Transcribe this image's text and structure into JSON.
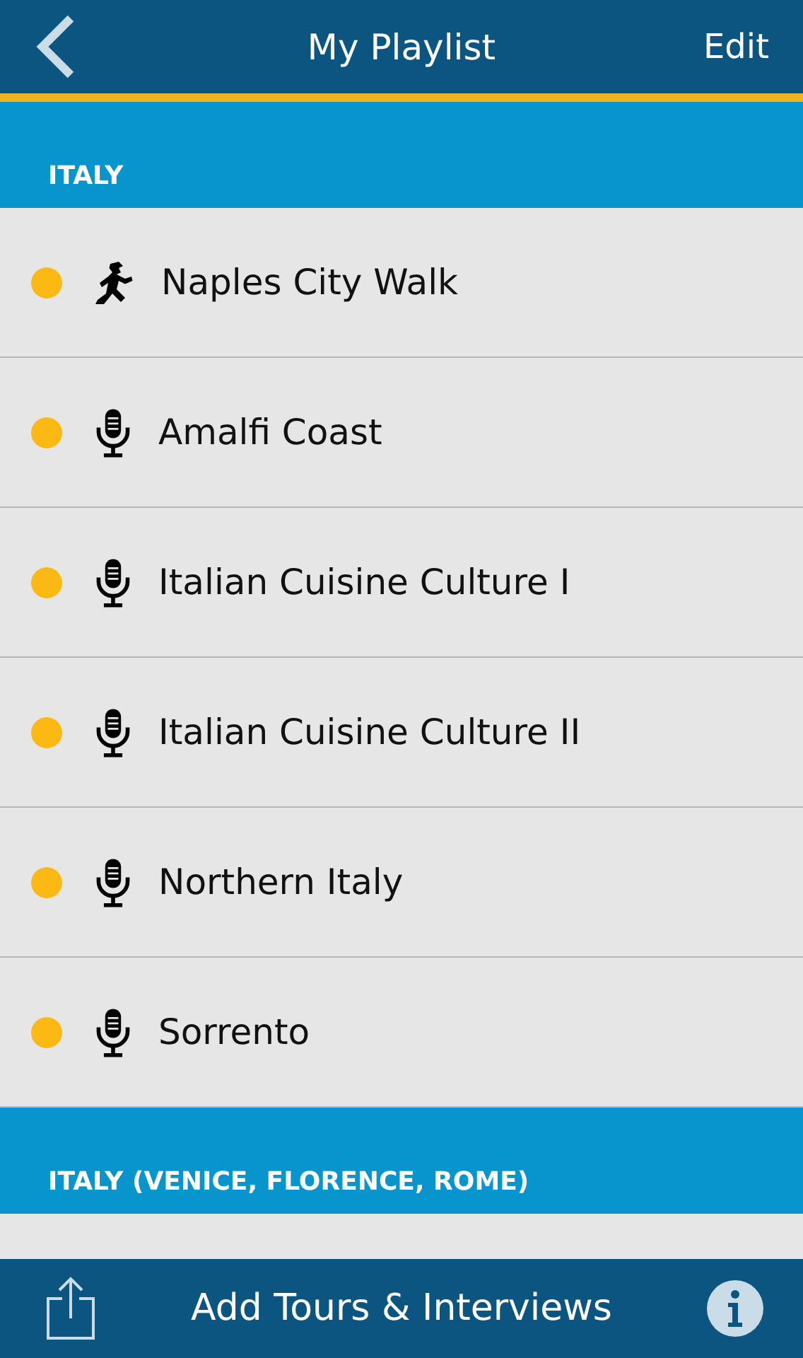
{
  "header": {
    "title": "My Playlist",
    "edit": "Edit"
  },
  "sections": [
    {
      "title": "ITALY",
      "items": [
        {
          "kind": "walk",
          "title": "Naples City Walk"
        },
        {
          "kind": "audio",
          "title": "Amalfi Coast"
        },
        {
          "kind": "audio",
          "title": "Italian Cuisine Culture I"
        },
        {
          "kind": "audio",
          "title": "Italian Cuisine Culture II"
        },
        {
          "kind": "audio",
          "title": "Northern Italy"
        },
        {
          "kind": "audio",
          "title": "Sorrento"
        }
      ]
    },
    {
      "title": "ITALY (VENICE, FLORENCE, ROME)"
    }
  ],
  "footer": {
    "label": "Add Tours & Interviews"
  }
}
